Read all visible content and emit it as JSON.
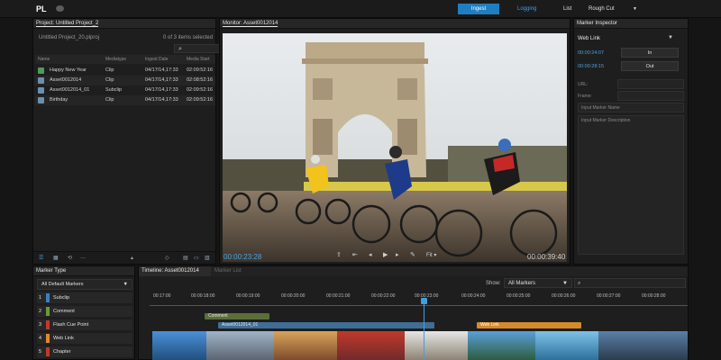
{
  "topbar": {
    "logo": "PL",
    "tabs": [
      "Ingest",
      "Logging",
      "List"
    ],
    "active_tab": "Ingest",
    "workspace": "Rough Cut"
  },
  "project": {
    "title": "Project: Untitled Project_2",
    "file": "Untitled Project_20.plproj",
    "count": "0 of 3 items selected",
    "columns": [
      "Name",
      "Mediatype",
      "Ingest Date",
      "Media Start"
    ],
    "rows": [
      {
        "name": "Happy New Year",
        "type": "Clip",
        "date": "04/17/14,17:33",
        "start": "02:09:52:16",
        "icon": "sequence-icon"
      },
      {
        "name": "Asset0012014",
        "type": "Clip",
        "date": "04/17/14,17:33",
        "start": "02:08:52:16",
        "icon": "clip-icon"
      },
      {
        "name": "Asset0012014_01",
        "type": "Subclip",
        "date": "04/17/14,17:33",
        "start": "02:09:52:16",
        "icon": "clip-icon"
      },
      {
        "name": "Birthday",
        "type": "Clip",
        "date": "04/17/14,17:33",
        "start": "02:09:52:16",
        "icon": "clip-icon"
      }
    ]
  },
  "monitor": {
    "title": "Monitor: Asset0012014",
    "timecode": "00:00:23:28",
    "duration": "00:00:39:40",
    "fit": "Fit"
  },
  "inspector": {
    "title": "Marker Inspector",
    "marker": "Web Link",
    "in_tc": "00:00:24:07",
    "out_tc": "00:00:28:15",
    "in_label": "In",
    "out_label": "Out",
    "url_key": "URL:",
    "frame_key": "Frame:",
    "name_placeholder": "Input Marker Name",
    "desc_placeholder": "Input Marker Description"
  },
  "marker_type": {
    "title": "Marker Type",
    "select": "All Default Markers",
    "items": [
      {
        "num": "1",
        "name": "Subclip",
        "color": "#3a7fc1"
      },
      {
        "num": "2",
        "name": "Comment",
        "color": "#6a9a3a"
      },
      {
        "num": "3",
        "name": "Flash Cue Point",
        "color": "#c0392b"
      },
      {
        "num": "4",
        "name": "Web Link",
        "color": "#e08a2b"
      },
      {
        "num": "5",
        "name": "Chapter",
        "color": "#c0392b"
      }
    ]
  },
  "timeline": {
    "title": "Timeline: Asset0012014",
    "tab2": "Marker List",
    "show_label": "Show:",
    "show_value": "All Markers",
    "ticks": [
      "00:17:00",
      "00:00:18:00",
      "00:00:19:00",
      "00:00:20:00",
      "00:00:21:00",
      "00:00:22:00",
      "00:00:23:00",
      "00:00:24:00",
      "00:00:25:00",
      "00:00:26:00",
      "00:00:27:00",
      "00:00:28:00"
    ],
    "markers": {
      "comment": "Comment",
      "subclip": "Asset0012014_01",
      "weblink": "Web Link"
    }
  }
}
